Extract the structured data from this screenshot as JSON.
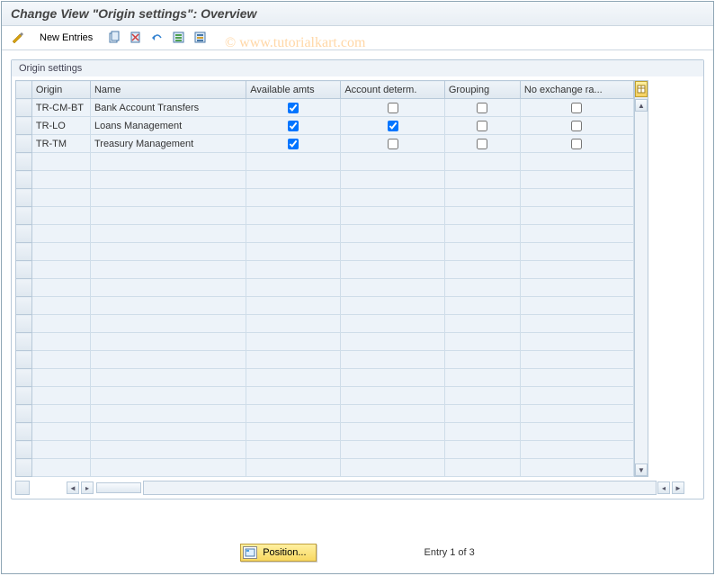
{
  "title": "Change View \"Origin settings\": Overview",
  "watermark": "© www.tutorialkart.com",
  "toolbar": {
    "new_entries": "New Entries"
  },
  "group": {
    "label": "Origin settings",
    "columns": {
      "origin": "Origin",
      "name": "Name",
      "available": "Available amts",
      "account": "Account determ.",
      "grouping": "Grouping",
      "noexch": "No exchange ra..."
    },
    "rows": [
      {
        "origin": "TR-CM-BT",
        "name": "Bank Account Transfers",
        "available": true,
        "account": false,
        "grouping": false,
        "noexch": false
      },
      {
        "origin": "TR-LO",
        "name": "Loans Management",
        "available": true,
        "account": true,
        "grouping": false,
        "noexch": false
      },
      {
        "origin": "TR-TM",
        "name": "Treasury Management",
        "available": true,
        "account": false,
        "grouping": false,
        "noexch": false
      }
    ]
  },
  "footer": {
    "position_label": "Position...",
    "entry_text": "Entry 1 of 3"
  }
}
